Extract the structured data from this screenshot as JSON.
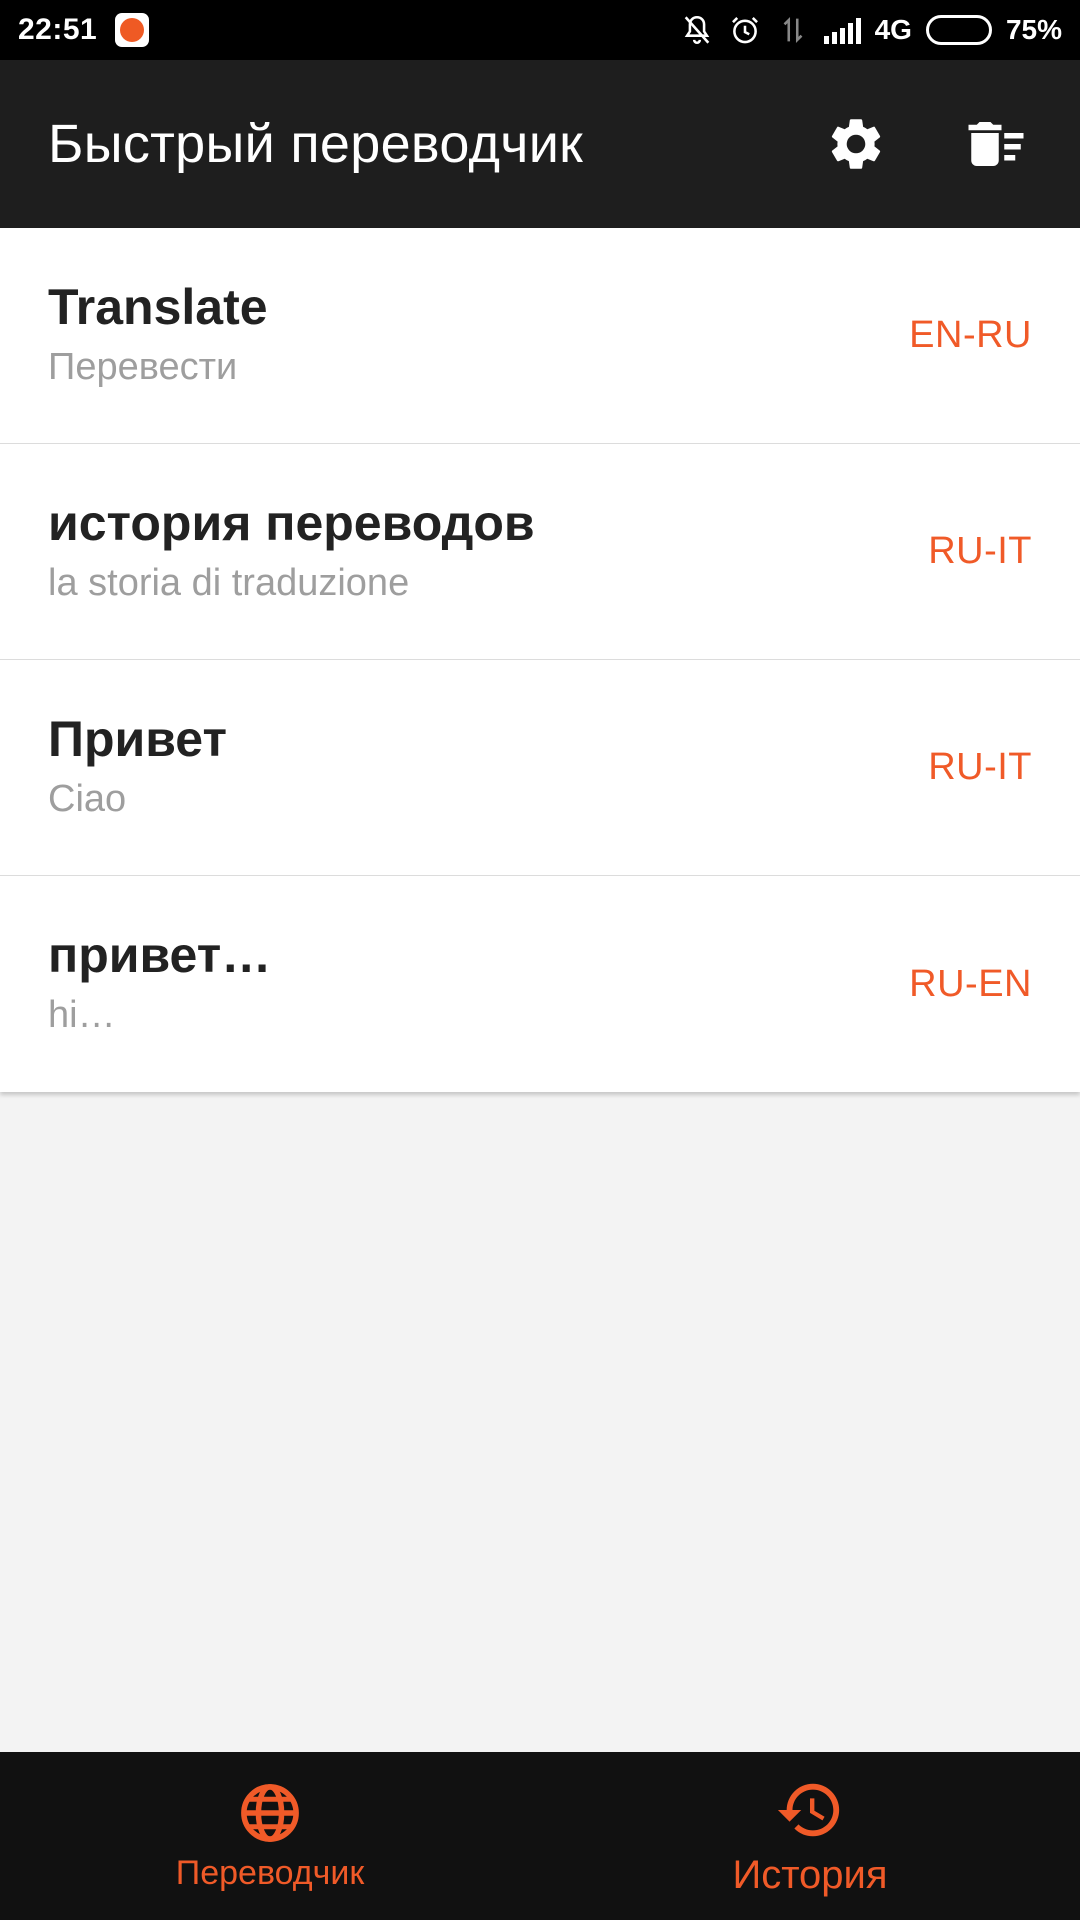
{
  "status_bar": {
    "time": "22:51",
    "network": "4G",
    "battery": "75%",
    "battery_level": 0.75
  },
  "app_bar": {
    "title": "Быстрый переводчик",
    "actions": [
      {
        "icon": "gear-icon"
      },
      {
        "icon": "clear-history-icon"
      }
    ]
  },
  "history": {
    "items": [
      {
        "source": "Translate",
        "translation": "Перевести",
        "lang": "EN-RU"
      },
      {
        "source": "история переводов",
        "translation": "la storia di traduzione",
        "lang": "RU-IT"
      },
      {
        "source": "Привет",
        "translation": "Ciao",
        "lang": "RU-IT"
      },
      {
        "source": "привет…",
        "translation": "hi…",
        "lang": "RU-EN"
      }
    ]
  },
  "bottom_nav": {
    "translator_label": "Переводчик",
    "history_label": "История"
  },
  "colors": {
    "accent": "#f05a28",
    "app_bar": "#1e1e1e",
    "background": "#f3f3f3"
  }
}
